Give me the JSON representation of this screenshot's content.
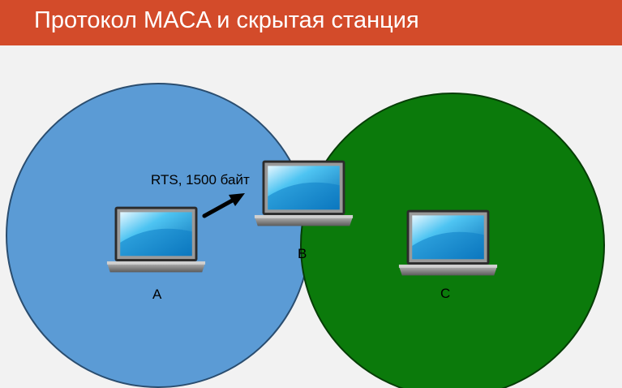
{
  "slide": {
    "title": "Протокол MACA и скрытая станция"
  },
  "diagram": {
    "message_label": "RTS, 1500 байт",
    "stations": [
      {
        "id": "A",
        "label": "A",
        "range_color": "#5b9bd5"
      },
      {
        "id": "B",
        "label": "B"
      },
      {
        "id": "C",
        "label": "C",
        "range_color": "#0b7a0b"
      }
    ],
    "colors": {
      "title_bar": "#d34b2a",
      "range_A": "#5b9bd5",
      "range_C": "#0b7a0b",
      "arrow": "#000000"
    },
    "icons": [
      "laptop-icon",
      "arrow-icon"
    ]
  }
}
